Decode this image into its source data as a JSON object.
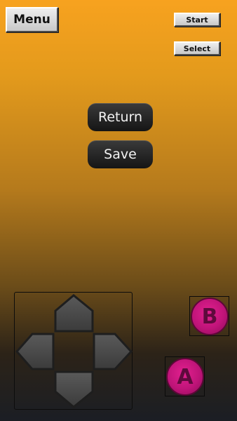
{
  "toolbar": {
    "menu_label": "Menu",
    "start_label": "Start",
    "select_label": "Select"
  },
  "dialog": {
    "return_label": "Return",
    "save_label": "Save"
  },
  "dpad": {
    "up_icon": "arrow-up-icon",
    "down_icon": "arrow-down-icon",
    "left_icon": "arrow-left-icon",
    "right_icon": "arrow-right-icon"
  },
  "action_buttons": {
    "a_label": "A",
    "b_label": "B",
    "color": "#c8147f"
  },
  "colors": {
    "background_top": "#f7a21f",
    "background_bottom": "#1b1e24",
    "dpad_fill": "#4a4a4a"
  }
}
